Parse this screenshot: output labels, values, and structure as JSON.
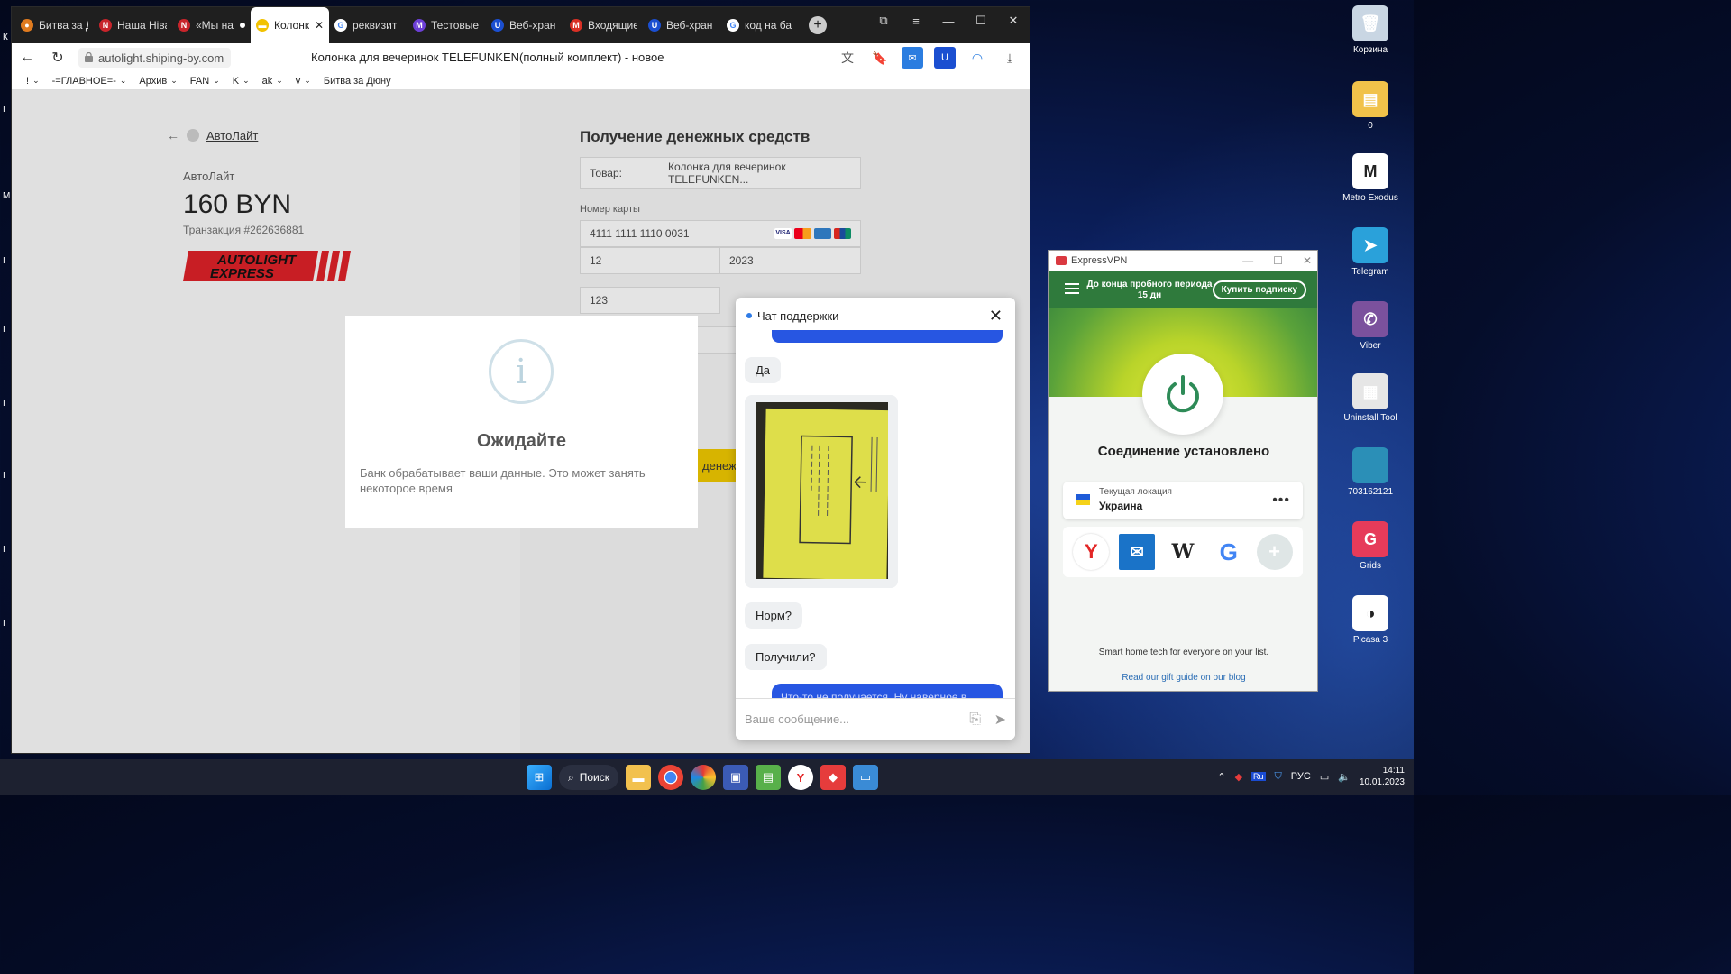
{
  "browser": {
    "tabs": [
      {
        "label": "Битва за Д",
        "color": "#e07b1f",
        "glyph": "●"
      },
      {
        "label": "Наша Ніва",
        "color": "#c8242b",
        "glyph": "N"
      },
      {
        "label": "«Мы на",
        "color": "#c8242b",
        "glyph": "N"
      },
      {
        "label": "Колонк",
        "color": "#f2c200",
        "glyph": "▬",
        "active": true
      },
      {
        "label": "реквизит",
        "color": "#ffffff",
        "glyph": "G"
      },
      {
        "label": "Тестовые",
        "color": "#6c3fd6",
        "glyph": "M"
      },
      {
        "label": "Веб-хран",
        "color": "#1b4fd1",
        "glyph": "U"
      },
      {
        "label": "Входящие",
        "color": "#d93025",
        "glyph": "M"
      },
      {
        "label": "Веб-хран",
        "color": "#1b4fd1",
        "glyph": "U"
      },
      {
        "label": "код на ба",
        "color": "#ffffff",
        "glyph": "G"
      }
    ],
    "url": "autolight.shiping-by.com",
    "page_title": "Колонка для вечеринок TELEFUNKEN(полный комплект) - новое",
    "bookmarks": [
      "!",
      "-=ГЛАВНОЕ=-",
      "Архив",
      "FAN",
      "K",
      "ak",
      "v",
      "Битва за Дюну"
    ]
  },
  "payment": {
    "back_label": "АвтоЛайт",
    "merchant": "АвтоЛайт",
    "amount": "160 BYN",
    "transaction": "Транзакция #262636881",
    "logo_line1": "AUTOLIGHT",
    "logo_line2": "EXPRESS",
    "title": "Получение денежных средств",
    "product_label": "Товар:",
    "product_value": "Колонка для вечеринок TELEFUNKEN...",
    "card_label": "Номер карты",
    "card_number": "4111 1111 1110 0031",
    "exp_month": "12",
    "exp_year": "2023",
    "cvv": "123",
    "pay_button_fragment": "денеж"
  },
  "modal": {
    "icon": "i",
    "title": "Ожидайте",
    "text": "Банк обрабатывает ваши данные. Это может занять некоторое время"
  },
  "chat": {
    "title": "Чат поддержки",
    "messages": [
      "Да",
      "Норм?",
      "Получили?"
    ],
    "outgoing_fragment": "Что-то не получается. Ну наверное в",
    "input_placeholder": "Ваше сообщение..."
  },
  "vpn": {
    "app_name": "ExpressVPN",
    "trial_text": "До конца пробного периода 15 дн",
    "buy_label": "Купить подписку",
    "status": "Соединение установлено",
    "location_label": "Текущая локация",
    "location": "Украина",
    "footer1": "Smart home tech for everyone on your list.",
    "footer2": "Read our gift guide on our blog"
  },
  "desktop": {
    "icons": [
      {
        "label": "Корзина",
        "color": "#c9d6e3",
        "glyph": "🗑"
      },
      {
        "label": "0",
        "color": "#f1c24a",
        "glyph": "▤"
      },
      {
        "label": "Metro Exodus",
        "color": "#ffffff",
        "glyph": "M"
      },
      {
        "label": "Telegram",
        "color": "#2aa1da",
        "glyph": "➤"
      },
      {
        "label": "Viber",
        "color": "#7b519d",
        "glyph": "✆"
      },
      {
        "label": "Uninstall Tool",
        "color": "#e6e6e6",
        "glyph": "▦"
      },
      {
        "label": "703162121",
        "color": "#2b8fb7",
        "glyph": ""
      },
      {
        "label": "Grids",
        "color": "#e63b5a",
        "glyph": "G"
      },
      {
        "label": "Picasa 3",
        "color": "#ffffff",
        "glyph": "◑"
      }
    ]
  },
  "taskbar": {
    "search_label": "Поиск",
    "lang": "РУС",
    "time": "14:11",
    "date": "10.01.2023",
    "tray_badge": "Ru"
  }
}
